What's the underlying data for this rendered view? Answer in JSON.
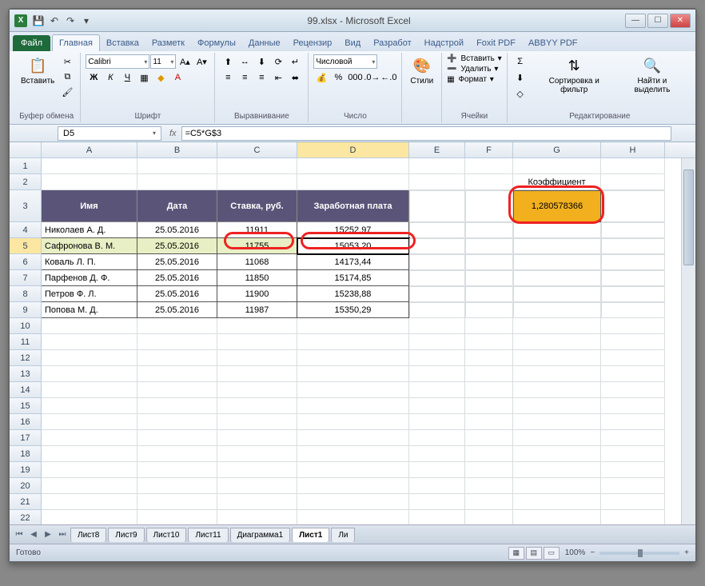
{
  "title": "99.xlsx - Microsoft Excel",
  "tabs": [
    "Файл",
    "Главная",
    "Вставка",
    "Разметк",
    "Формулы",
    "Данные",
    "Рецензир",
    "Вид",
    "Разработ",
    "Надстрой",
    "Foxit PDF",
    "ABBYY PDF"
  ],
  "active_tab": "Главная",
  "ribbon": {
    "clipboard": {
      "paste": "Вставить",
      "label": "Буфер обмена"
    },
    "font": {
      "name": "Calibri",
      "size": "11",
      "label": "Шрифт"
    },
    "align": {
      "label": "Выравнивание"
    },
    "number": {
      "format": "Числовой",
      "label": "Число"
    },
    "styles": {
      "btn": "Стили",
      "label": ""
    },
    "cells": {
      "insert": "Вставить",
      "delete": "Удалить",
      "format": "Формат",
      "label": "Ячейки"
    },
    "editing": {
      "sort": "Сортировка и фильтр",
      "find": "Найти и выделить",
      "label": "Редактирование"
    }
  },
  "namebox": "D5",
  "formula": "=C5*G$3",
  "coeff_label": "Коэффициент",
  "coeff_value": "1,280578366",
  "columns": [
    "A",
    "B",
    "C",
    "D",
    "E",
    "F",
    "G",
    "H"
  ],
  "headers": [
    "Имя",
    "Дата",
    "Ставка, руб.",
    "Заработная плата"
  ],
  "rows": [
    {
      "name": "Николаев А. Д.",
      "date": "25.05.2016",
      "rate": "11911",
      "salary": "15252,97"
    },
    {
      "name": "Сафронова В. М.",
      "date": "25.05.2016",
      "rate": "11755",
      "salary": "15053,20"
    },
    {
      "name": "Коваль Л. П.",
      "date": "25.05.2016",
      "rate": "11068",
      "salary": "14173,44"
    },
    {
      "name": "Парфенов Д. Ф.",
      "date": "25.05.2016",
      "rate": "11850",
      "salary": "15174,85"
    },
    {
      "name": "Петров Ф. Л.",
      "date": "25.05.2016",
      "rate": "11900",
      "salary": "15238,88"
    },
    {
      "name": "Попова М. Д.",
      "date": "25.05.2016",
      "rate": "11987",
      "salary": "15350,29"
    }
  ],
  "sheets": [
    "Лист8",
    "Лист9",
    "Лист10",
    "Лист11",
    "Диаграмма1",
    "Лист1",
    "Ли"
  ],
  "active_sheet": "Лист1",
  "status": "Готово",
  "zoom": "100%"
}
